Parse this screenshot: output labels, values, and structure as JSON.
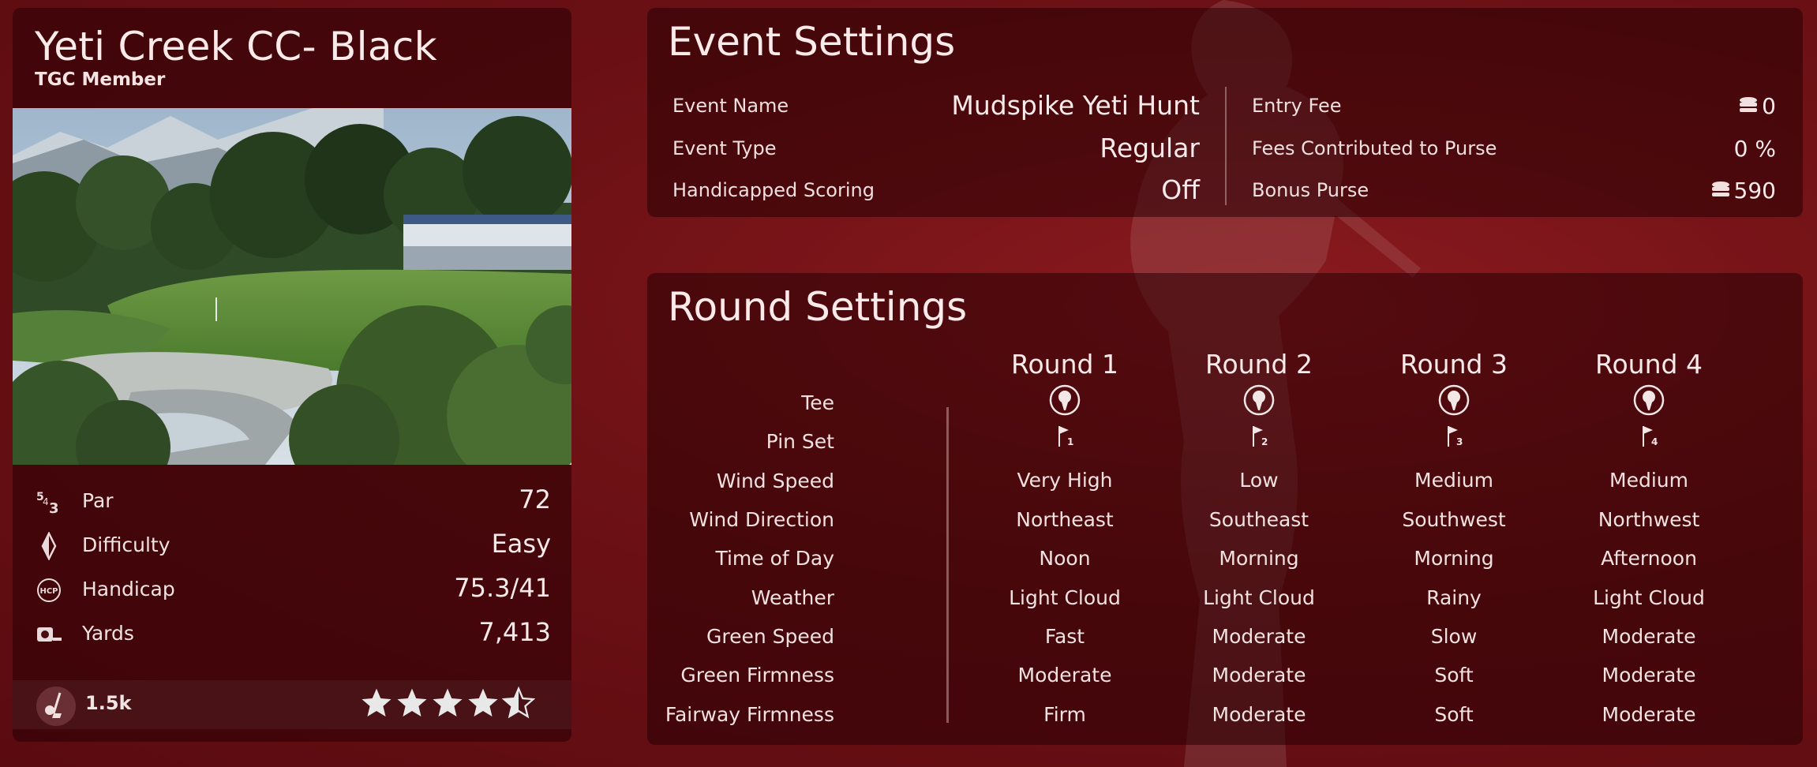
{
  "course": {
    "title": "Yeti Creek CC- Black",
    "subtitle": "TGC Member",
    "stats": [
      {
        "icon": "par-icon",
        "label": "Par",
        "value": "72"
      },
      {
        "icon": "difficulty-icon",
        "label": "Difficulty",
        "value": "Easy"
      },
      {
        "icon": "handicap-icon",
        "label": "Handicap",
        "value": "75.3/41"
      },
      {
        "icon": "yards-icon",
        "label": "Yards",
        "value": "7,413"
      }
    ],
    "handicap_icon_text": "HCP",
    "plays": "1.5k",
    "rating_stars": 4.5,
    "rating_max": 5
  },
  "event": {
    "title": "Event Settings",
    "left": [
      {
        "label": "Event Name",
        "value": "Mudspike Yeti Hunt"
      },
      {
        "label": "Event Type",
        "value": "Regular"
      },
      {
        "label": "Handicapped Scoring",
        "value": "Off"
      }
    ],
    "right": [
      {
        "label": "Entry Fee",
        "value": "0",
        "coin": true
      },
      {
        "label": "Fees Contributed to Purse",
        "value": "0 %",
        "coin": false
      },
      {
        "label": "Bonus Purse",
        "value": "590",
        "coin": true
      }
    ]
  },
  "rounds": {
    "title": "Round Settings",
    "row_labels": [
      "Tee",
      "Pin Set",
      "Wind Speed",
      "Wind Direction",
      "Time of Day",
      "Weather",
      "Green Speed",
      "Green Firmness",
      "Fairway Firmness"
    ],
    "columns": [
      {
        "name": "Round 1",
        "pin": "1",
        "wind_speed": "Very High",
        "wind_direction": "Northeast",
        "time_of_day": "Noon",
        "weather": "Light Cloud",
        "green_speed": "Fast",
        "green_firmness": "Moderate",
        "fairway_firmness": "Firm"
      },
      {
        "name": "Round 2",
        "pin": "2",
        "wind_speed": "Low",
        "wind_direction": "Southeast",
        "time_of_day": "Morning",
        "weather": "Light Cloud",
        "green_speed": "Moderate",
        "green_firmness": "Moderate",
        "fairway_firmness": "Moderate"
      },
      {
        "name": "Round 3",
        "pin": "3",
        "wind_speed": "Medium",
        "wind_direction": "Southwest",
        "time_of_day": "Morning",
        "weather": "Rainy",
        "green_speed": "Slow",
        "green_firmness": "Soft",
        "fairway_firmness": "Soft"
      },
      {
        "name": "Round 4",
        "pin": "4",
        "wind_speed": "Medium",
        "wind_direction": "Northwest",
        "time_of_day": "Afternoon",
        "weather": "Light Cloud",
        "green_speed": "Moderate",
        "green_firmness": "Moderate",
        "fairway_firmness": "Moderate"
      }
    ]
  },
  "colors": {
    "background": "#6d1115",
    "panel": "#2a0004",
    "text": "#f3e6e6",
    "star": "#e8e8e8"
  }
}
